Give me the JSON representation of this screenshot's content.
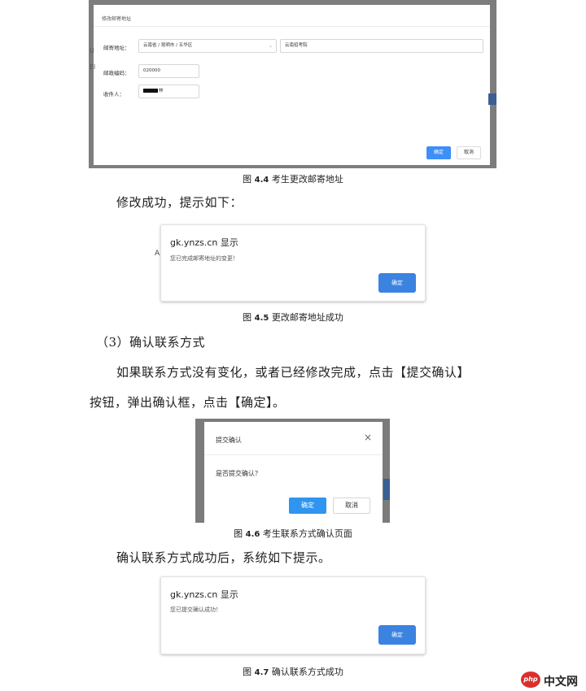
{
  "fig44": {
    "dialog_title": "修改邮寄地址",
    "address_label": "邮寄地址：",
    "region_value": "云南省 / 昆明市 / 五华区",
    "street_value": "云南招考院",
    "postcode_label": "邮政编码：",
    "postcode_value": "020000",
    "recipient_label": "收件人：",
    "recipient_value": "林",
    "ok_label": "确定",
    "cancel_label": "取消",
    "caption_prefix": "图",
    "caption_num": "4.4",
    "caption_text": "考生更改邮寄地址",
    "side_fragments": [
      "U",
      "El"
    ]
  },
  "para_success": "修改成功，提示如下：",
  "fig45": {
    "host": "gk.ynzs.cn 显示",
    "message": "您已完成邮寄地址的变更！",
    "ok_label": "确定",
    "fragment": "A",
    "caption_prefix": "图",
    "caption_num": "4.5",
    "caption_text": "更改邮寄地址成功"
  },
  "section_heading": "（3）确认联系方式",
  "para_confirm_1": "如果联系方式没有变化，或者已经修改完成，点击【提交确认】",
  "para_confirm_2": "按钮，弹出确认框，点击【确定】。",
  "fig46": {
    "title": "提交确认",
    "close_symbol": "×",
    "question": "是否提交确认？",
    "ok_label": "确定",
    "cancel_label": "取消",
    "caption_prefix": "图",
    "caption_num": "4.6",
    "caption_text": "考生联系方式确认页面"
  },
  "para_after": "确认联系方式成功后，系统如下提示。",
  "fig47": {
    "host": "gk.ynzs.cn 显示",
    "message": "您已提交确认成功！",
    "ok_label": "确定",
    "caption_prefix": "图",
    "caption_num": "4.7",
    "caption_text": "确认联系方式成功"
  },
  "watermark": {
    "logo": "php",
    "text": "中文网"
  }
}
